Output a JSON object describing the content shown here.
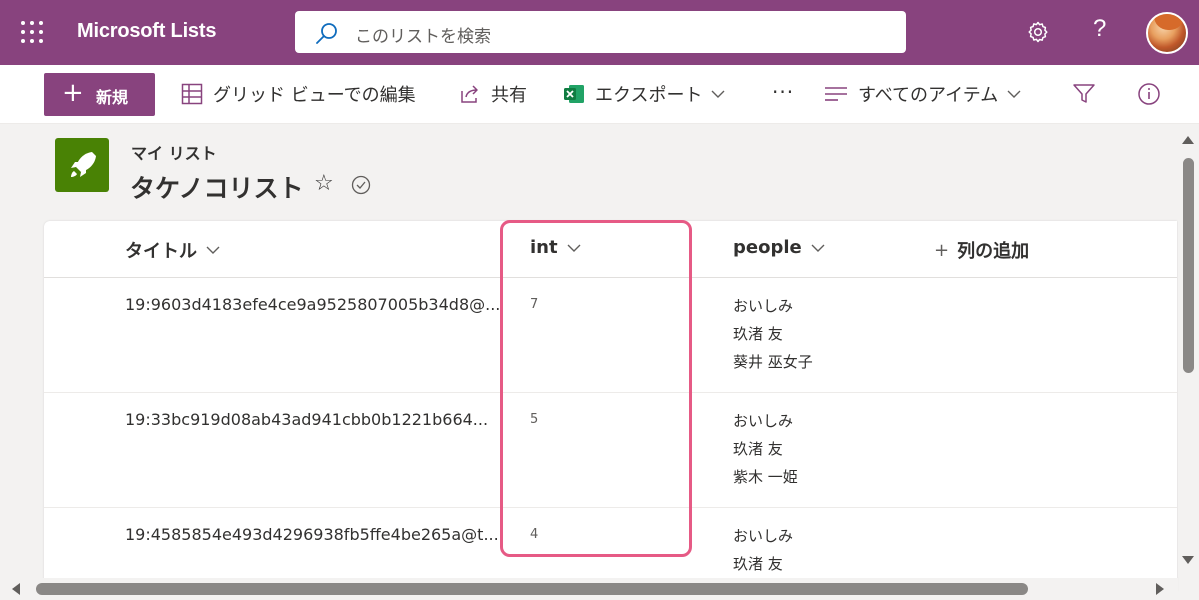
{
  "app": {
    "title": "Microsoft Lists"
  },
  "search": {
    "placeholder": "このリストを検索"
  },
  "commands": {
    "new_label": "新規",
    "grid_edit_label": "グリッド ビューでの編集",
    "share_label": "共有",
    "export_label": "エクスポート",
    "more_label": "···",
    "view_label": "すべてのアイテム"
  },
  "list": {
    "breadcrumb": "マイ リスト",
    "title": "タケノコリスト"
  },
  "columns": {
    "title": "タイトル",
    "int": "int",
    "people": "people",
    "add_column": "列の追加"
  },
  "rows": [
    {
      "title": "19:9603d4183efe4ce9a9525807005b34d8@...",
      "int": "7",
      "people": [
        "おいしみ",
        "玖渚 友",
        "葵井 巫女子"
      ]
    },
    {
      "title": "19:33bc919d08ab43ad941cbb0b1221b664...",
      "int": "5",
      "people": [
        "おいしみ",
        "玖渚 友",
        "紫木 一姫"
      ]
    },
    {
      "title": "19:4585854e493d4296938fb5ffe4be265a@t...",
      "int": "4",
      "people": [
        "おいしみ",
        "玖渚 友",
        ""
      ]
    }
  ],
  "colors": {
    "brand": "#88437e",
    "list_icon": "#498205",
    "highlight": "#e65a85"
  }
}
